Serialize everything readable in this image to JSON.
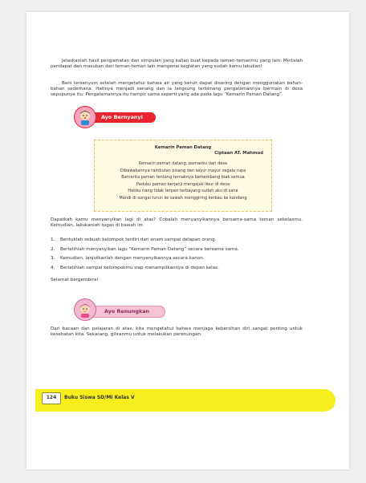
{
  "paragraphs": {
    "p1": "Jelaskanlah hasil pengamatan dan simpulan yang kalian buat kepada teman-temanmu yang lain. Mintalah pendapat dan masukan dari teman-teman lain mengenai kegiatan yang sudah kamu lakukan!",
    "p2": "Beni tersenyum setelah mengetahui bahwa air yang keruh dapat disaring dengan menggunakan bahan-bahan sederhana. Hatinya menjadi senang dan ia langsung terkenang pengalamannya bermain di desa sepupunya itu. Pengalamannya itu hampir sama seperti yang ada pada lagu “Kemarin Paman Datang”.",
    "p3": "Dapatkah kamu menyanyikan lagi di atas? Cobalah menyanyikannya bersama-sama teman sekelasmu. Kemudian, lakukanlah tugas di bawah ini.",
    "closing": "Selamat bergembira!",
    "p4": "Dari bacaan dan pelajaran di atas, kita mengetahui bahwa menjaga kebersihan diri sangat penting untuk kesehatan kita. Sekarang, giliranmu untuk melakukan perenungan."
  },
  "sections": {
    "sing_label": "Ayo Bernyanyi",
    "reflect_label": "Ayo Renungkan"
  },
  "song": {
    "title": "Kemarin Paman Datang",
    "author": "Ciptaan AT. Mahmud",
    "lines": [
      "Kemarin paman datang, pamanku dari desa",
      "Dibawakannya rambutan pisang dan sayur mayur segala rupa",
      "Bercerita paman tentang ternaknya berkembang biak semua",
      "Paduku paman berjanji mengajak libur di desa",
      "Hatiku riang tidak terperi terbayang sudah aku di sana",
      "Mandi di sungai turun ke sawah menggiring kerbau ke kandang"
    ]
  },
  "tasks": [
    {
      "num": "1.",
      "text": "Bentuklah sebuah kelompok terdiri dari enam sampai delapan orang."
    },
    {
      "num": "2.",
      "text": "Berlatihlah menyanyikan lagu “Kemarin Paman Datang” secara bersama sama."
    },
    {
      "num": "3.",
      "text": "Kemudian, lanjutkanlah dengan menyanyikannya secara kanon."
    },
    {
      "num": "4.",
      "text": "Berlatihlah sampai kelompokmu siap menampilkannya di depan kelas."
    }
  ],
  "footer": {
    "page_number": "124",
    "book_title": "Buku Siswa SD/MI Kelas V"
  },
  "colors": {
    "sing_banner": "#e8242d",
    "reflect_banner": "#f7c2d4",
    "footer_band": "#f7ee1e"
  },
  "icons": {
    "sing": "girl-singing-icon",
    "reflect": "girl-thinking-icon",
    "page_tab": "book-page-icon"
  }
}
